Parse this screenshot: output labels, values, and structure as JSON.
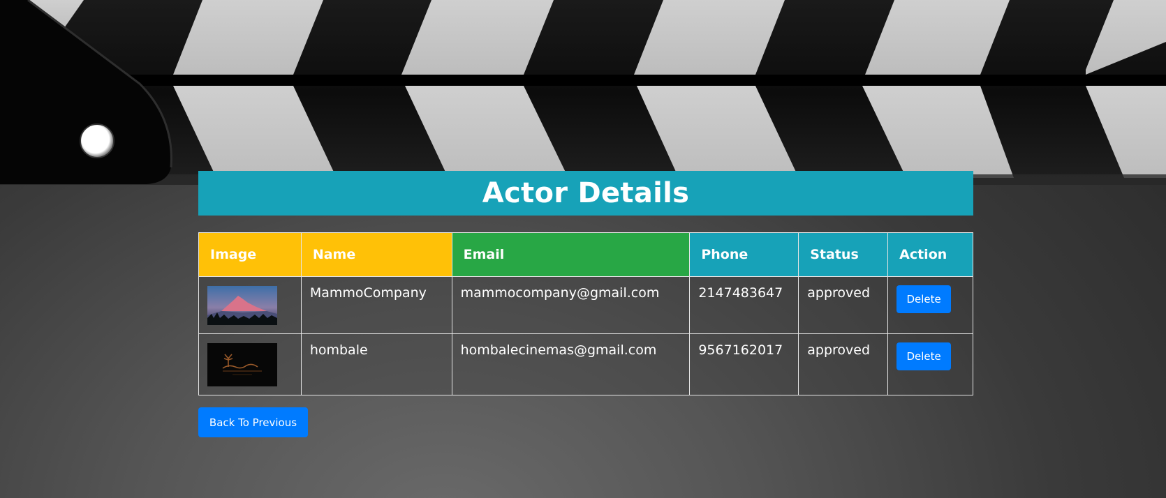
{
  "page": {
    "title": "Actor Details"
  },
  "table": {
    "headers": {
      "image": "Image",
      "name": "Name",
      "email": "Email",
      "phone": "Phone",
      "status": "Status",
      "action": "Action"
    },
    "rows": [
      {
        "image": "mountain-sunset-thumbnail",
        "name": "MammoCompany",
        "email": "mammocompany@gmail.com",
        "phone": "2147483647",
        "status": "approved",
        "action_label": "Delete"
      },
      {
        "image": "hombale-logo-thumbnail",
        "name": "hombale",
        "email": "hombalecinemas@gmail.com",
        "phone": "9567162017",
        "status": "approved",
        "action_label": "Delete"
      }
    ]
  },
  "back_button_label": "Back To Previous",
  "colors": {
    "title_bg": "#17a2b8",
    "header_yellow": "#ffc107",
    "header_green": "#28a745",
    "header_teal": "#17a2b8",
    "button_blue": "#007bff"
  }
}
